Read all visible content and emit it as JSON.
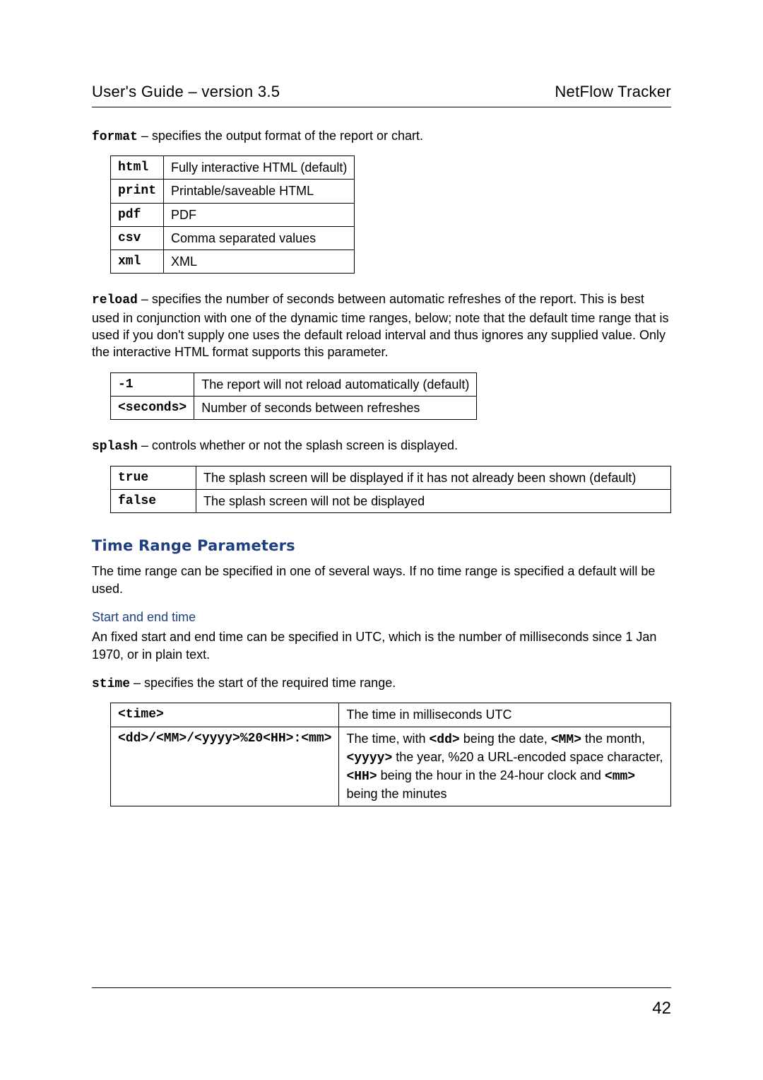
{
  "header": {
    "left": "User's Guide – version 3.5",
    "right": "NetFlow Tracker"
  },
  "page_number": "42",
  "params": {
    "format": {
      "name": "format",
      "desc": " – specifies the output format of the report or chart.",
      "rows": [
        {
          "k": "html",
          "v": "Fully interactive HTML (default)"
        },
        {
          "k": "print",
          "v": "Printable/saveable HTML"
        },
        {
          "k": "pdf",
          "v": "PDF"
        },
        {
          "k": "csv",
          "v": "Comma separated values"
        },
        {
          "k": "xml",
          "v": "XML"
        }
      ]
    },
    "reload": {
      "name": "reload",
      "desc": " – specifies the number of seconds between automatic refreshes of the report. This is best used in conjunction with one of the dynamic time ranges, below; note that the default time range that is used if you don't supply one uses the default reload interval and thus ignores any supplied value. Only the interactive HTML format supports this parameter.",
      "rows": [
        {
          "k": "-1",
          "v": "The report will not reload automatically (default)"
        },
        {
          "k": "<seconds>",
          "v": "Number of seconds between refreshes"
        }
      ]
    },
    "splash": {
      "name": "splash",
      "desc": " – controls whether or not the splash screen is displayed.",
      "rows": [
        {
          "k": "true",
          "v": "The splash screen will be displayed if it has not already been shown (default)"
        },
        {
          "k": "false",
          "v": "The splash screen will not be displayed"
        }
      ]
    },
    "stime": {
      "name": "stime",
      "desc": " – specifies the start of the required time range.",
      "rows": [
        {
          "k": "<time>",
          "v": "The time in milliseconds UTC"
        },
        {
          "k": "<dd>/<MM>/<yyyy>%20<HH>:<mm>",
          "v_html": "The time, with <span class=\"inline-mono\">&lt;dd&gt;</span> being the date, <span class=\"inline-mono\">&lt;MM&gt;</span> the month, <span class=\"inline-mono\">&lt;yyyy&gt;</span> the year, %20 a URL-encoded space character, <span class=\"inline-mono\">&lt;HH&gt;</span> being the hour in the 24-hour clock and <span class=\"inline-mono\">&lt;mm&gt;</span> being the minutes"
        }
      ]
    }
  },
  "section": {
    "time_range_heading": "Time Range Parameters",
    "time_range_intro": "The time range can be specified in one of several ways. If no time range is specified a default will be used.",
    "start_end_heading": "Start and end time",
    "start_end_body": "An fixed start and end time can be specified in UTC, which is the number of milliseconds since 1 Jan 1970, or in plain text."
  }
}
